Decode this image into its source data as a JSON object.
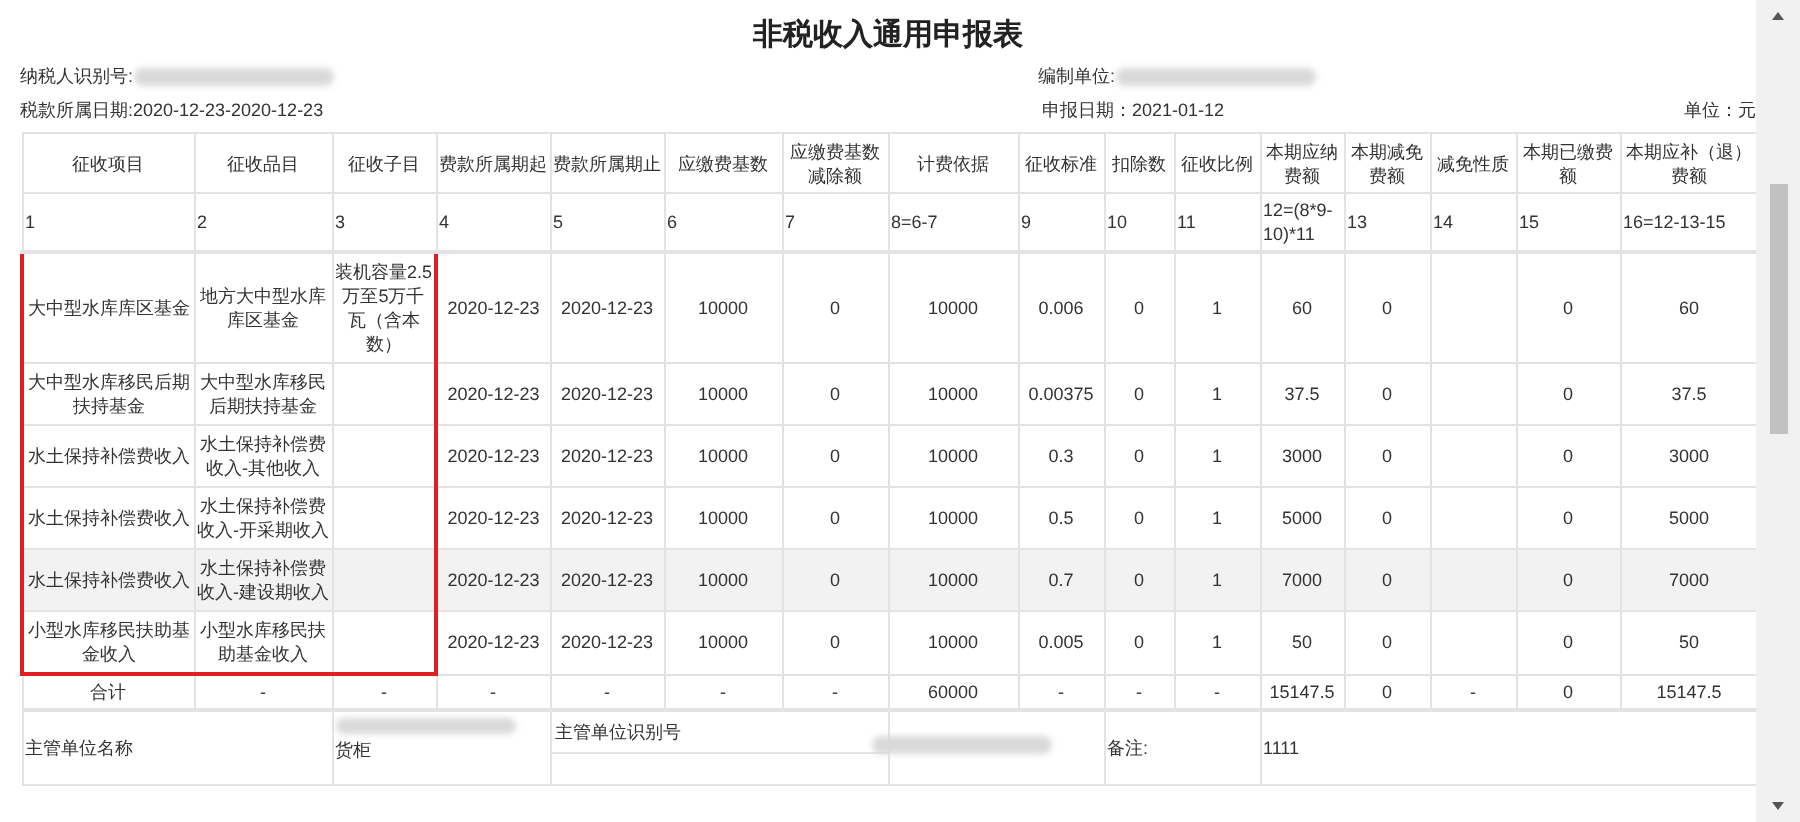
{
  "title": "非税收入通用申报表",
  "taxpayer_id_label": "纳税人识别号:",
  "compiler_label": "编制单位:",
  "period": "税款所属日期:2020-12-23-2020-12-23",
  "report_date": "申报日期：2021-01-12",
  "unit": "单位：元",
  "columns": [
    "征收项目",
    "征收品目",
    "征收子目",
    "费款所属期起",
    "费款所属期止",
    "应缴费基数",
    "应缴费基数减除额",
    "计费依据",
    "征收标准",
    "扣除数",
    "征收比例",
    "本期应纳费额",
    "本期减免费额",
    "减免性质",
    "本期已缴费额",
    "本期应补（退）费额"
  ],
  "column_numbers": [
    "1",
    "2",
    "3",
    "4",
    "5",
    "6",
    "7",
    "8=6-7",
    "9",
    "10",
    "11",
    "12=(8*9-10)*11",
    "13",
    "14",
    "15",
    "16=12-13-15"
  ],
  "rows": [
    {
      "highlighted": false,
      "framed": true,
      "cells": [
        "大中型水库库区基金",
        "地方大中型水库库区基金",
        "装机容量2.5万至5万千瓦（含本数）",
        "2020-12-23",
        "2020-12-23",
        "10000",
        "0",
        "10000",
        "0.006",
        "0",
        "1",
        "60",
        "0",
        "",
        "0",
        "60"
      ]
    },
    {
      "highlighted": false,
      "framed": true,
      "cells": [
        "大中型水库移民后期扶持基金",
        "大中型水库移民后期扶持基金",
        "",
        "2020-12-23",
        "2020-12-23",
        "10000",
        "0",
        "10000",
        "0.00375",
        "0",
        "1",
        "37.5",
        "0",
        "",
        "0",
        "37.5"
      ]
    },
    {
      "highlighted": false,
      "framed": true,
      "cells": [
        "水土保持补偿费收入",
        "水土保持补偿费收入-其他收入",
        "",
        "2020-12-23",
        "2020-12-23",
        "10000",
        "0",
        "10000",
        "0.3",
        "0",
        "1",
        "3000",
        "0",
        "",
        "0",
        "3000"
      ]
    },
    {
      "highlighted": false,
      "framed": true,
      "cells": [
        "水土保持补偿费收入",
        "水土保持补偿费收入-开采期收入",
        "",
        "2020-12-23",
        "2020-12-23",
        "10000",
        "0",
        "10000",
        "0.5",
        "0",
        "1",
        "5000",
        "0",
        "",
        "0",
        "5000"
      ]
    },
    {
      "highlighted": true,
      "framed": true,
      "cells": [
        "水土保持补偿费收入",
        "水土保持补偿费收入-建设期收入",
        "",
        "2020-12-23",
        "2020-12-23",
        "10000",
        "0",
        "10000",
        "0.7",
        "0",
        "1",
        "7000",
        "0",
        "",
        "0",
        "7000"
      ]
    },
    {
      "highlighted": false,
      "framed": true,
      "cells": [
        "小型水库移民扶助基金收入",
        "小型水库移民扶助基金收入",
        "",
        "2020-12-23",
        "2020-12-23",
        "10000",
        "0",
        "10000",
        "0.005",
        "0",
        "1",
        "50",
        "0",
        "",
        "0",
        "50"
      ]
    }
  ],
  "total": [
    "合计",
    "-",
    "-",
    "-",
    "-",
    "-",
    "-",
    "60000",
    "-",
    "-",
    "-",
    "15147.5",
    "0",
    "-",
    "0",
    "15147.5"
  ],
  "footer": {
    "authority_name_label": "主管单位名称",
    "authority_name_value": "货柜",
    "authority_id_label": "主管单位识别号",
    "remarks_label": "备注:",
    "remarks_value": "1111"
  }
}
